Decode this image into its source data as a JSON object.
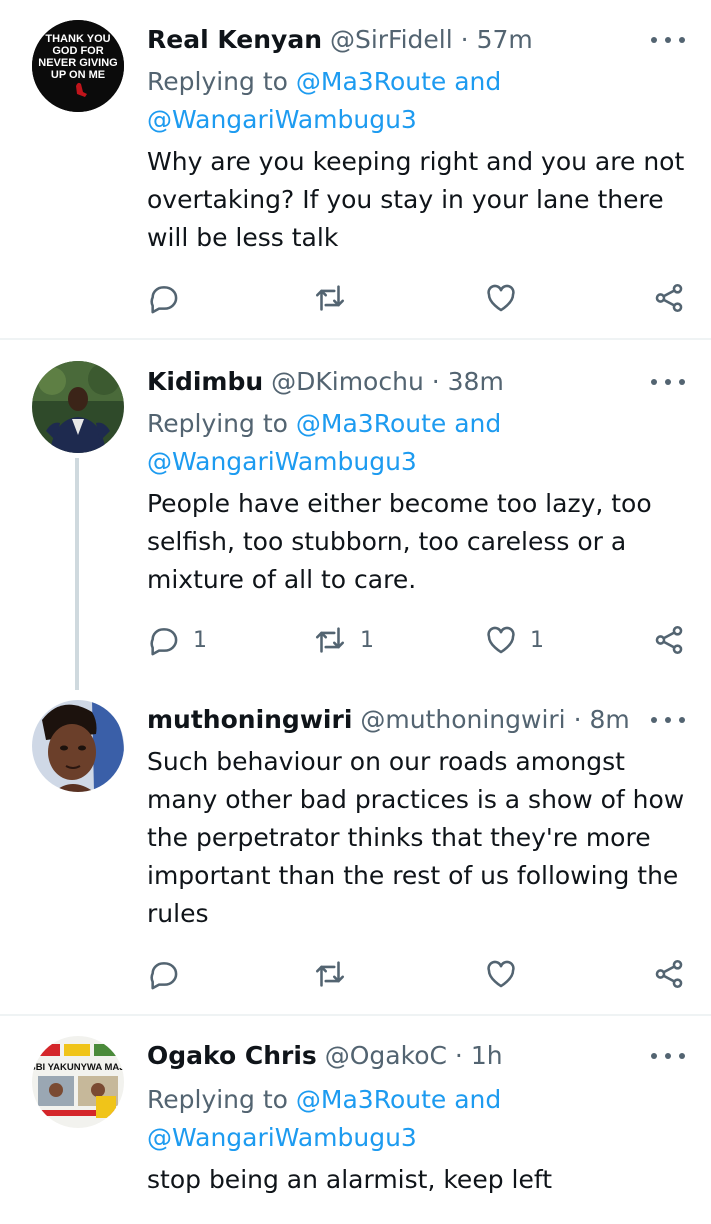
{
  "tweets": [
    {
      "avatar_text": [
        "THANK YOU",
        "GOD FOR",
        "NEVER GIVING",
        "UP ON ME"
      ],
      "name": "Real Kenyan",
      "handle": "@SirFidell",
      "dot": "·",
      "time": "57m",
      "replying_prefix": "Replying to",
      "replying_mention1": "@Ma3Route",
      "replying_and": "and",
      "replying_mention2": "@WangariWambugu3",
      "text": "Why are you keeping right and you are not overtaking? If you stay in your lane there will be less talk",
      "reply_count": "",
      "retweet_count": "",
      "like_count": ""
    },
    {
      "name": "Kidimbu",
      "handle": "@DKimochu",
      "dot": "·",
      "time": "38m",
      "replying_prefix": "Replying to",
      "replying_mention1": "@Ma3Route",
      "replying_and": "and",
      "replying_mention2": "@WangariWambugu3",
      "text": "People have either become too lazy, too selfish, too stubborn, too careless or a mixture of all to care.",
      "reply_count": "1",
      "retweet_count": "1",
      "like_count": "1"
    },
    {
      "name": "muthoningwiri",
      "handle": "@muthoningwiri",
      "dot": "·",
      "time": "8m",
      "text": "Such behaviour on our roads amongst many other bad practices is a show of how the perpetrator thinks that they're more important than the rest of us following the rules",
      "reply_count": "",
      "retweet_count": "",
      "like_count": ""
    },
    {
      "avatar_text": "BBI YAKUNYWA MAJI",
      "name": "Ogako Chris",
      "handle": "@OgakoC",
      "dot": "·",
      "time": "1h",
      "replying_prefix": "Replying to",
      "replying_mention1": "@Ma3Route",
      "replying_and": "and",
      "replying_mention2": "@WangariWambugu3",
      "text": "stop being an alarmist, keep left"
    }
  ],
  "icons": {
    "reply": "reply-icon",
    "retweet": "retweet-icon",
    "like": "heart-icon",
    "share": "share-icon",
    "more": "more-icon"
  },
  "colors": {
    "accent": "#1d9bf0",
    "secondary_text": "#536471",
    "primary_text": "#0f1419",
    "divider": "#eff3f4",
    "thread_line": "#cfd9de"
  }
}
